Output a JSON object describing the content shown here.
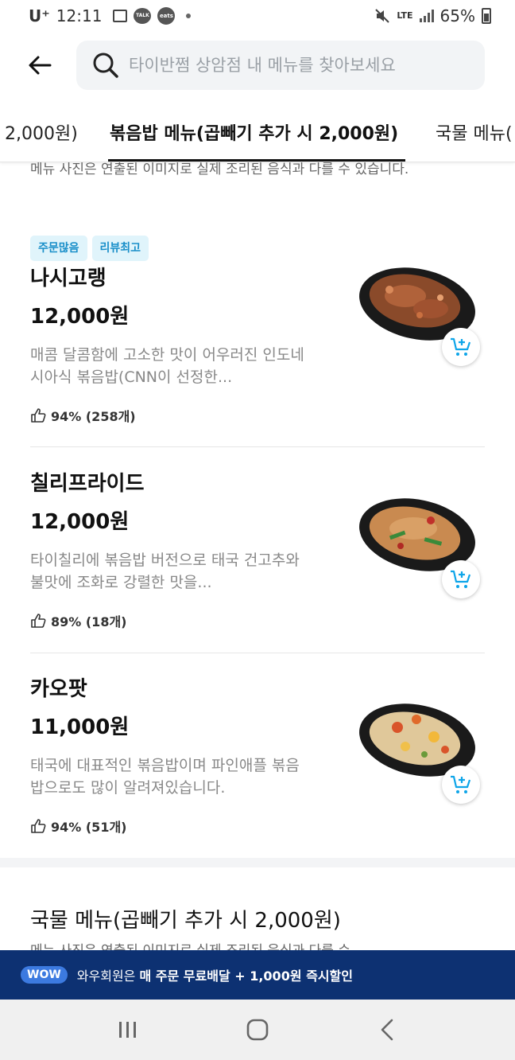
{
  "status_bar": {
    "carrier": "U⁺",
    "time": "12:11",
    "notif_talk": "TALK",
    "notif_eats": "eats",
    "network": "LTE",
    "battery": "65%"
  },
  "header": {
    "search_placeholder": "타이반쩜 상암점 내 메뉴를 찾아보세요"
  },
  "tabs": [
    {
      "label": "2,000원)"
    },
    {
      "label": "볶음밥 메뉴(곱빼기 추가 시 2,000원)",
      "active": true
    },
    {
      "label": "국물 메뉴("
    }
  ],
  "notice": "메뉴 사진은 연출된 이미지로 실제 조리된 음식과 다를 수 있습니다.",
  "items": [
    {
      "badges": [
        "주문많음",
        "리뷰최고"
      ],
      "name": "나시고랭",
      "price": "12,000원",
      "desc": "매콤 달콤함에 고소한 맛이 어우러진 인도네시아식 볶음밥(CNN이 선정한...",
      "rating": "94% (258개)"
    },
    {
      "badges": [],
      "name": "칠리프라이드",
      "price": "12,000원",
      "desc": "타이칠리에 볶음밥 버전으로 태국 건고추와 불맛에 조화로 강렬한 맛을...",
      "rating": "89% (18개)"
    },
    {
      "badges": [],
      "name": "카오팟",
      "price": "11,000원",
      "desc": "태국에 대표적인 볶음밥이며 파인애플 볶음밥으로도 많이 알려져있습니다.",
      "rating": "94% (51개)"
    }
  ],
  "next_section": {
    "title": "국물 메뉴(곱빼기 추가 시 2,000원)",
    "notice": "메뉴 사진은 연출된 이미지로 실제 조리된 음식과 다를 수"
  },
  "wow_banner": {
    "pill": "WOW",
    "text_prefix": "와우회원은 ",
    "text_bold": "매 주문 무료배달 + 1,000원 즉시할인"
  },
  "colors": {
    "accent_blue": "#1a8fc9",
    "badge_bg": "#e0f4fb",
    "wow_bg": "#0d3172"
  }
}
